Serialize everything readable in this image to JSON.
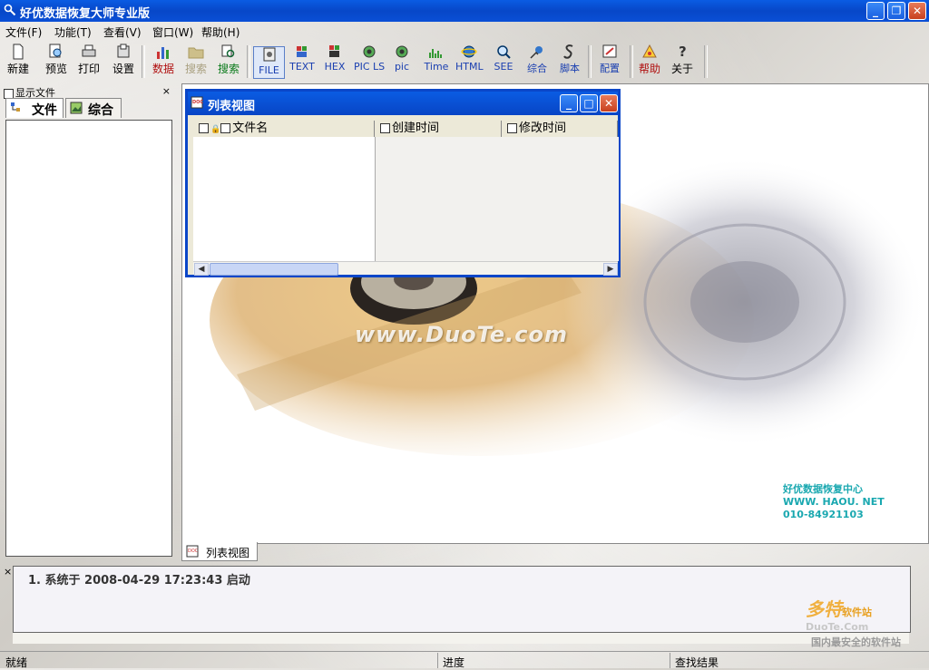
{
  "app": {
    "title": "好优数据恢复大师专业版"
  },
  "menu": [
    {
      "label": "文件(F)"
    },
    {
      "label": "功能(T)"
    },
    {
      "label": "查看(V)"
    },
    {
      "label": "窗口(W)"
    },
    {
      "label": "帮助(H)"
    }
  ],
  "toolbar": {
    "new": "新建",
    "preview": "预览",
    "print": "打印",
    "settings": "设置",
    "data": "数据",
    "search_disabled": "搜索",
    "search": "搜索",
    "file": "FILE",
    "text": "TEXT",
    "hex": "HEX",
    "picls": "PIC LS",
    "pic": "pic",
    "time": "Time",
    "html": "HTML",
    "see": "SEE",
    "general": "综合",
    "script": "脚本",
    "config": "配置",
    "help": "帮助",
    "about": "关于"
  },
  "left_panel": {
    "header": "显示文件",
    "close": "×",
    "tab_files": "文件",
    "tab_general": "综合"
  },
  "child_window": {
    "title": "列表视图",
    "columns": [
      "文件名",
      "创建时间",
      "修改时间"
    ]
  },
  "background": {
    "watermark": "www.DuoTe.com",
    "contact": [
      "好优数据恢复中心",
      "WWW. HAOU. NET",
      "010-84921103"
    ]
  },
  "doc_tab": "列表视图",
  "log": {
    "close": "×",
    "line": "1. 系统于 2008-04-29 17:23:43 启动"
  },
  "status": {
    "ready": "就绪",
    "progress": "进度",
    "results": "查找结果"
  },
  "brand": {
    "name": "多特",
    "suffix": "软件站",
    "url": "DuoTe.Com",
    "tagline": "国内最安全的软件站"
  },
  "colors": {
    "titlebar": "#0a4fd6",
    "close_button": "#c8401f"
  }
}
